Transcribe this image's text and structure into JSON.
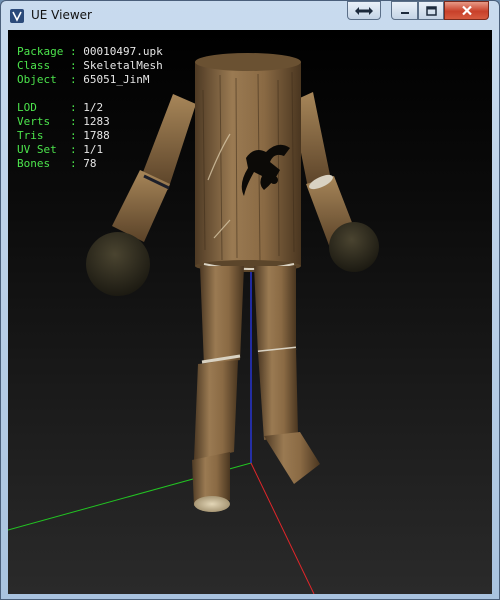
{
  "window": {
    "title": "UE Viewer",
    "buttons": [
      "swap-icon",
      "minimize-icon",
      "maximize-icon",
      "close-icon"
    ]
  },
  "info": {
    "package": {
      "label": "Package :",
      "value": "00010497.upk"
    },
    "class": {
      "label": "Class   :",
      "value": "SkeletalMesh"
    },
    "object": {
      "label": "Object  :",
      "value": "65051_JinM"
    },
    "lod": {
      "label": "LOD     :",
      "value": "1/2"
    },
    "verts": {
      "label": "Verts   :",
      "value": "1283"
    },
    "tris": {
      "label": "Tris    :",
      "value": "1788"
    },
    "uvset": {
      "label": "UV Set  :",
      "value": "1/1"
    },
    "bones": {
      "label": "Bones   :",
      "value": "78"
    }
  },
  "colors": {
    "info_label": "#4ce44c",
    "info_value": "#e6e6e6",
    "axis_x": "#e0262a",
    "axis_y": "#22c322",
    "axis_z": "#2a3bff",
    "wood": "#8a6a44"
  }
}
